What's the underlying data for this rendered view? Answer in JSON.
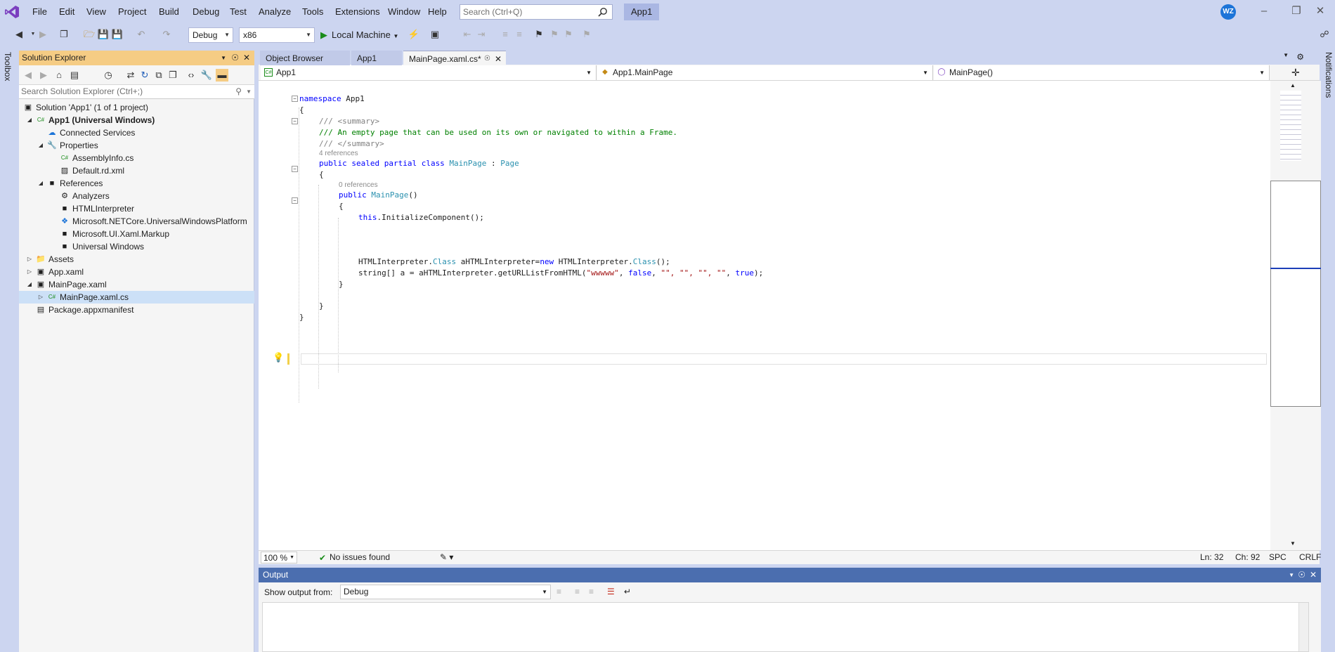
{
  "menubar": {
    "items": [
      "File",
      "Edit",
      "View",
      "Project",
      "Build",
      "Debug",
      "Test",
      "Analyze",
      "Tools",
      "Extensions",
      "Window",
      "Help"
    ],
    "search_placeholder": "Search (Ctrl+Q)",
    "solution_name": "App1",
    "avatar_initials": "WZ"
  },
  "toolbar": {
    "configuration": "Debug",
    "platform": "x86",
    "run_label": "Local Machine"
  },
  "side_strips": {
    "left": "Toolbox",
    "right": "Notifications"
  },
  "solution_explorer": {
    "title": "Solution Explorer",
    "search_placeholder": "Search Solution Explorer (Ctrl+;)",
    "tree": [
      {
        "label": "Solution 'App1' (1 of 1 project)",
        "icon": "solution-icon",
        "expander": "",
        "bold": false
      },
      {
        "label": "App1 (Universal Windows)",
        "icon": "csharp-project-icon",
        "expander": "expanded",
        "bold": true
      },
      {
        "label": "Connected Services",
        "icon": "connected-services-icon",
        "expander": "",
        "bold": false
      },
      {
        "label": "Properties",
        "icon": "wrench-icon",
        "expander": "expanded",
        "bold": false
      },
      {
        "label": "AssemblyInfo.cs",
        "icon": "csharp-file-icon",
        "expander": "",
        "bold": false
      },
      {
        "label": "Default.rd.xml",
        "icon": "xml-file-icon",
        "expander": "",
        "bold": false
      },
      {
        "label": "References",
        "icon": "references-icon",
        "expander": "expanded",
        "bold": false
      },
      {
        "label": "Analyzers",
        "icon": "analyzer-icon",
        "expander": "",
        "bold": false
      },
      {
        "label": "HTMLInterpreter",
        "icon": "reference-icon",
        "expander": "",
        "bold": false
      },
      {
        "label": "Microsoft.NETCore.UniversalWindowsPlatform",
        "icon": "nuget-icon",
        "expander": "",
        "bold": false
      },
      {
        "label": "Microsoft.UI.Xaml.Markup",
        "icon": "reference-icon",
        "expander": "",
        "bold": false
      },
      {
        "label": "Universal Windows",
        "icon": "reference-icon",
        "expander": "",
        "bold": false
      },
      {
        "label": "Assets",
        "icon": "folder-icon",
        "expander": "collapsed",
        "bold": false
      },
      {
        "label": "App.xaml",
        "icon": "xaml-file-icon",
        "expander": "collapsed",
        "bold": false
      },
      {
        "label": "MainPage.xaml",
        "icon": "xaml-file-icon",
        "expander": "expanded",
        "bold": false
      },
      {
        "label": "MainPage.xaml.cs",
        "icon": "csharp-file-icon",
        "expander": "collapsed",
        "bold": false,
        "selected": true
      },
      {
        "label": "Package.appxmanifest",
        "icon": "manifest-icon",
        "expander": "",
        "bold": false
      }
    ]
  },
  "editor_tabs": [
    {
      "label": "Object Browser",
      "active": false
    },
    {
      "label": "App1",
      "active": false
    },
    {
      "label": "MainPage.xaml.cs*",
      "active": true
    }
  ],
  "navbar": {
    "project": "App1",
    "type": "App1.MainPage",
    "member": "MainPage()"
  },
  "code": {
    "namespace_kw": "namespace",
    "namespace_name": "App1",
    "open_brace": "{",
    "close_brace": "}",
    "summary_open": "/// <summary>",
    "summary_text": "/// An empty page that can be used on its own or navigated to within a Frame.",
    "summary_close": "/// </summary>",
    "class_refs": "4 references",
    "class_decl_kw": "public sealed partial class",
    "class_name": "MainPage",
    "class_sep": " : ",
    "base_name": "Page",
    "ctor_refs": "0 references",
    "ctor_kw": "public",
    "ctor_name": "MainPage",
    "ctor_parens": "()",
    "this_kw": "this",
    "init_call": ".InitializeComponent();",
    "line1_a": "HTMLInterpreter.",
    "line1_cls": "Class",
    "line1_b": " aHTMLInterpreter=",
    "line1_new": "new",
    "line1_c": " HTMLInterpreter.",
    "line1_cls2": "Class",
    "line1_d": "();",
    "line2_a": "string[] a = aHTMLInterpreter.getURLListFromHTML(",
    "line2_str1": "\"wwwww\"",
    "line2_sep1": ", ",
    "line2_false": "false",
    "line2_sep2": ", ",
    "line2_strs": "\"\", \"\", \"\", \"\"",
    "line2_sep3": ", ",
    "line2_true": "true",
    "line2_end": ");"
  },
  "statusbar": {
    "zoom": "100 %",
    "issues": "No issues found",
    "line": "Ln: 32",
    "col": "Ch: 92",
    "whitespace": "SPC",
    "line_ending": "CRLF"
  },
  "output": {
    "title": "Output",
    "show_from_label": "Show output from:",
    "source": "Debug"
  },
  "colors": {
    "chrome": "#ccd5f0",
    "accent": "#f5cc84",
    "output_title": "#4b6eaf",
    "vs_purple": "#68217a"
  }
}
